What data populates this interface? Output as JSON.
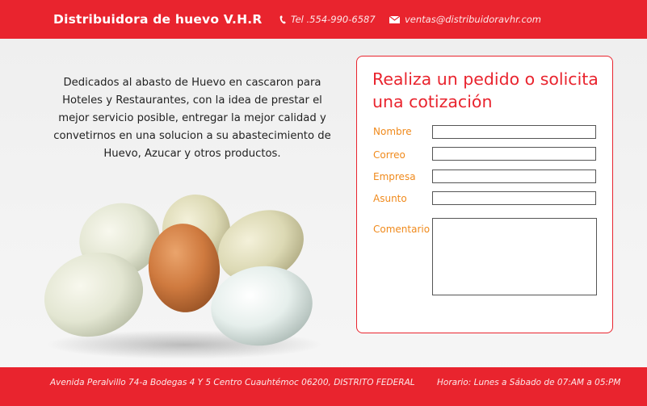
{
  "header": {
    "brand": "Distribuidora de huevo V.H.R",
    "phone": "Tel .554-990-6587",
    "email": "ventas@distribuidoravhr.com",
    "phone_icon": "phone-icon",
    "email_icon": "envelope-icon"
  },
  "intro": {
    "text": "Dedicados al abasto de Huevo en cascaron para Hoteles y Restaurantes, con la idea de prestar el mejor servicio posible, entregar la mejor calidad y convetirnos en una solucion a su abastecimiento de Huevo, Azucar y otros productos."
  },
  "form": {
    "title": "Realiza un pedido o solicita una cotización",
    "fields": [
      {
        "label": "Nombre",
        "value": ""
      },
      {
        "label": "Correo",
        "value": ""
      },
      {
        "label": "Empresa",
        "value": ""
      },
      {
        "label": "Asunto",
        "value": ""
      }
    ],
    "comment_label": "Comentario",
    "comment_value": ""
  },
  "footer": {
    "address": "Avenida Peralvillo 74-a Bodegas 4 Y 5 Centro Cuauhtémoc 06200, DISTRITO FEDERAL",
    "hours": "Horario: Lunes a Sábado de 07:AM a 05:PM"
  },
  "colors": {
    "brand_red": "#e9242e",
    "label_orange": "#f08a1c"
  }
}
